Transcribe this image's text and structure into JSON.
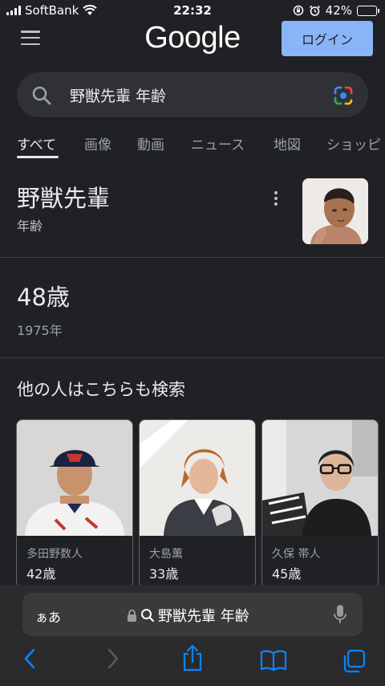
{
  "status_bar": {
    "carrier": "SoftBank",
    "time": "22:32",
    "battery": "42%",
    "battery_level": 0.42
  },
  "header": {
    "logo": "Google",
    "login_label": "ログイン"
  },
  "search": {
    "query": "野獣先輩 年齢"
  },
  "tabs": [
    {
      "label": "すべて",
      "active": true
    },
    {
      "label": "画像"
    },
    {
      "label": "動画"
    },
    {
      "label": "ニュース"
    },
    {
      "label": "地図"
    },
    {
      "label": "ショッピ"
    }
  ],
  "entity": {
    "title": "野獣先輩",
    "subtitle": "年齢"
  },
  "answer": {
    "value": "48歳",
    "sub": "1975年"
  },
  "people_also_search": {
    "heading": "他の人はこちらも検索",
    "people": [
      {
        "name": "多田野数人",
        "age": "42歳"
      },
      {
        "name": "大島薫",
        "age": "33歳"
      },
      {
        "name": "久保 帯人",
        "age": "45歳"
      }
    ]
  },
  "safari": {
    "aa_label": "ぁあ",
    "url_text": "野獣先輩 年齢"
  },
  "colors": {
    "background": "#202124",
    "accent": "#8ab4f8",
    "searchbox": "#303134"
  }
}
